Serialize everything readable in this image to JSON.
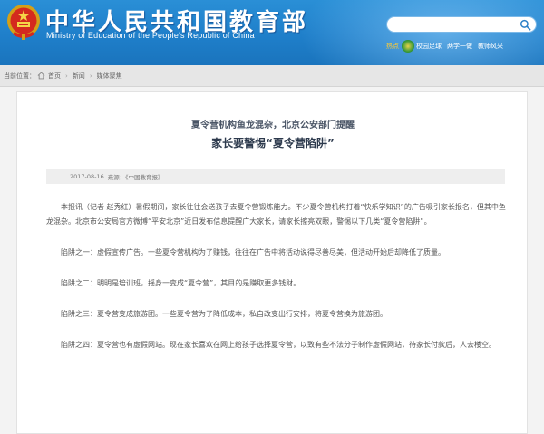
{
  "header": {
    "site_title": "中华人民共和国教育部",
    "site_subtitle": "Ministry of Education of the People's Republic of China",
    "search_placeholder": "",
    "quicklinks_label": "热点",
    "quicklinks": [
      "校园足球",
      "两学一做",
      "教师风采"
    ],
    "colors": {
      "header_blue": "#1f7fca",
      "title_white": "#ffffff",
      "label_gold": "#ffcc33"
    }
  },
  "breadcrumb": {
    "prefix": "当前位置：",
    "items": [
      "首页",
      "新闻",
      "媒体聚焦"
    ]
  },
  "article": {
    "subtitle": "夏令营机构鱼龙混杂，北京公安部门提醒",
    "title": "家长要警惕“夏令营陷阱”",
    "date": "2017-08-16",
    "source": "来源：《中国教育报》",
    "paragraphs": [
      "本报讯（记者 赵秀红）暑假期间，家长往往会送孩子去夏令营锻炼能力。不少夏令营机构打着“快乐学知识”的广告吸引家长报名，但其中鱼龙混杂。北京市公安局官方微博“平安北京”近日发布信息提醒广大家长，请家长擦亮双眼，警惕以下几类“夏令营陷阱”。",
      "陷阱之一：虚假宣传广告。一些夏令营机构为了赚钱，往往在广告中将活动说得尽善尽美，但活动开始后却降低了质量。",
      "陷阱之二：明明是培训班，摇身一变成“夏令营”，其目的是赚取更多钱财。",
      "陷阱之三：夏令营变成旅游团。一些夏令营为了降低成本，私自改变出行安排，将夏令营换为旅游团。",
      "陷阱之四：夏令营也有虚假网站。现在家长喜欢在网上给孩子选择夏令营，以致有些不法分子制作虚假网站，待家长付款后，人去楼空。"
    ]
  }
}
